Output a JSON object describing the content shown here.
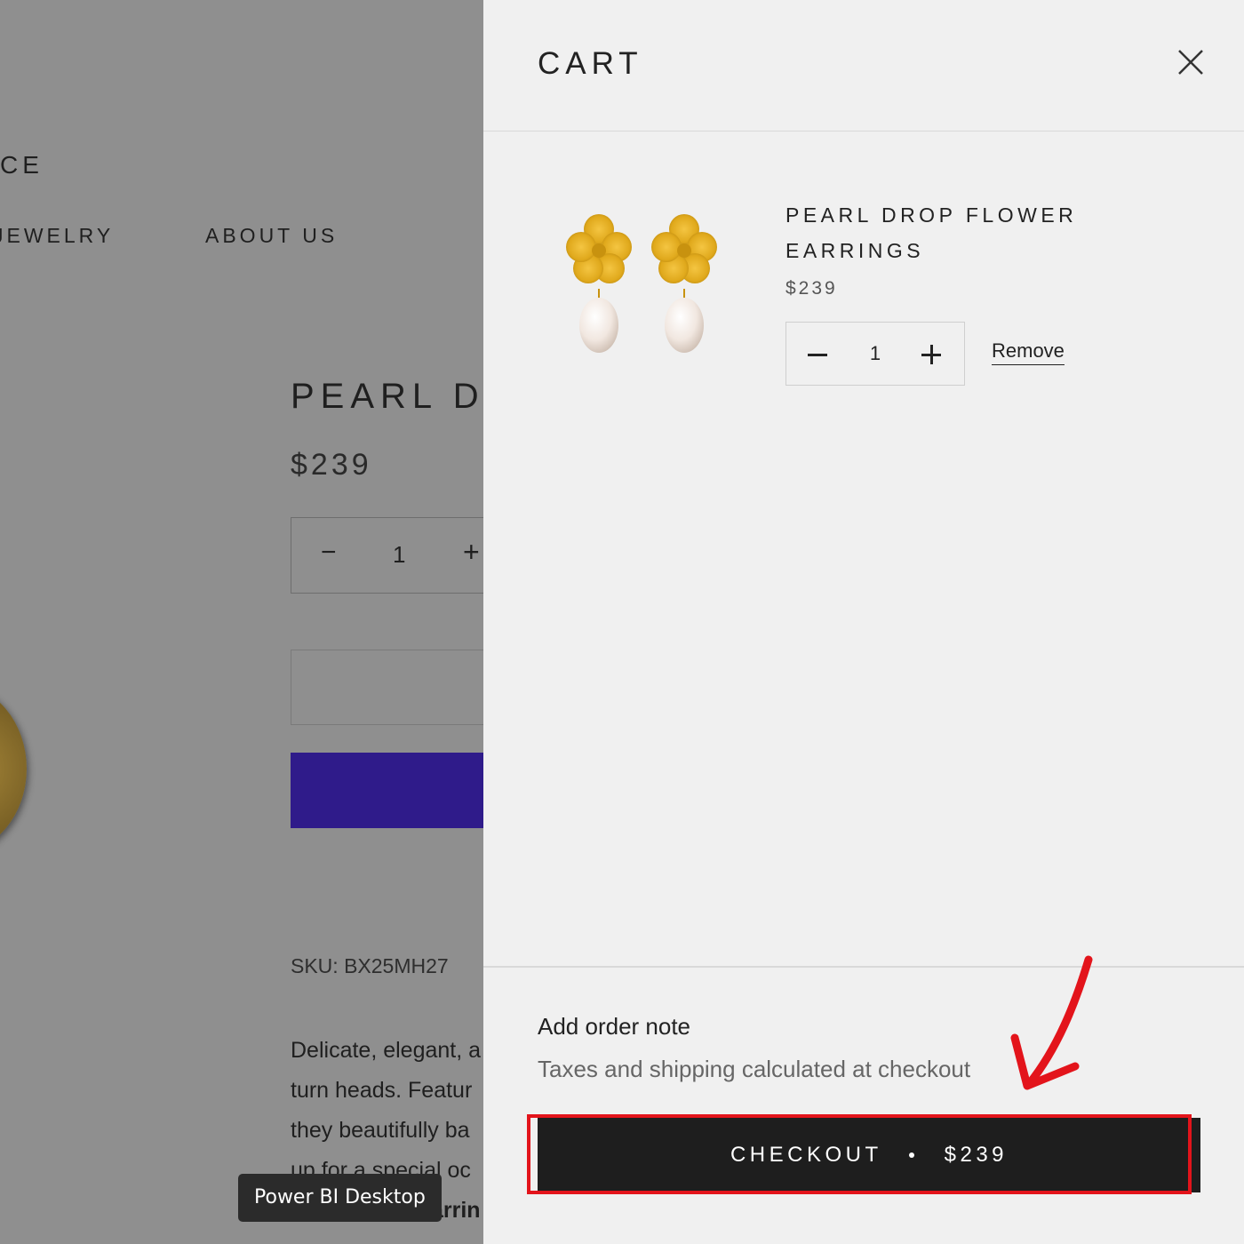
{
  "background_page": {
    "brand_partial": "CE",
    "nav": [
      "JEWELRY",
      "ABOUT US"
    ],
    "product_title_partial": "PEARL D",
    "price": "$239",
    "quantity": {
      "minus": "−",
      "value": "1",
      "plus": "+"
    },
    "sku": "SKU: BX25MH27",
    "description_lines": [
      "Delicate, elegant, a",
      "turn heads. Featur",
      "they beautifully ba",
      "up for a special oc"
    ],
    "tooltip": "Power BI Desktop",
    "partial_text": "arrin"
  },
  "cart": {
    "title": "CART",
    "close_icon": "close-icon",
    "item": {
      "title_line1": "PEARL DROP FLOWER",
      "title_line2": "EARRINGS",
      "price": "$239",
      "quantity": "1",
      "remove_label": "Remove",
      "image_icon": "pearl-flower-earrings-image"
    },
    "order_note_label": "Add order note",
    "taxes_note": "Taxes and shipping calculated at checkout",
    "checkout": {
      "label": "CHECKOUT",
      "total": "$239"
    }
  },
  "colors": {
    "overlay": "#8f8f8f",
    "drawer_bg": "#f0f0f0",
    "checkout_bg": "#1e1e1e",
    "buy_now_bg": "#2f1b8a",
    "annotation_red": "#e3141b",
    "gold": "#e0a91c"
  }
}
